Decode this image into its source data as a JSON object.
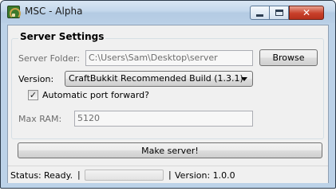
{
  "window": {
    "title": "MSC - Alpha",
    "controls": {
      "minimize_icon": "minimize-icon",
      "maximize_icon": "maximize-icon",
      "close_glyph": "✕"
    }
  },
  "server_settings": {
    "legend": "Server Settings",
    "folder_label": "Server Folder:",
    "folder_value": "C:\\Users\\Sam\\Desktop\\server",
    "browse_label": "Browse",
    "version_label": "Version:",
    "version_selected": "CraftBukkit Recommended Build (1.3.1)",
    "port_forward_label": "Automatic port forward?",
    "port_forward_checked": true,
    "port_forward_mark": "✓",
    "ram_label": "Max RAM:",
    "ram_value": "5120"
  },
  "actions": {
    "make_server_label": "Make server!"
  },
  "status": {
    "status_label": "Status:",
    "status_value": "Ready.",
    "separator": "|",
    "progress_fraction": 0,
    "version_text": "Version: 1.0.0"
  }
}
